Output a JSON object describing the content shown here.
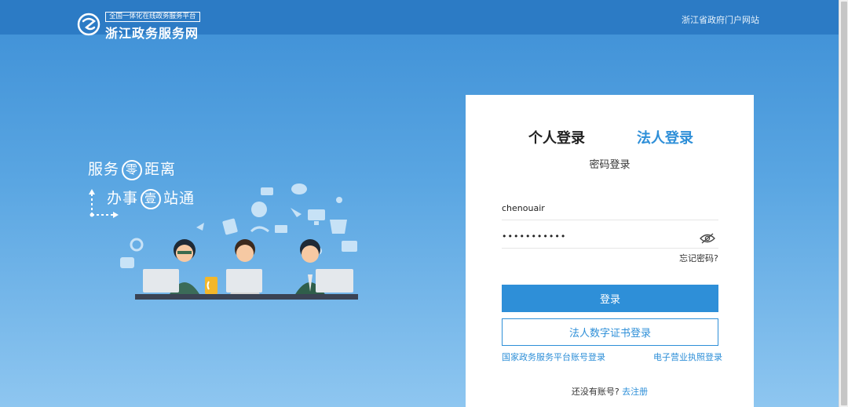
{
  "header": {
    "logo_tagline": "全国一体化在线政务服务平台",
    "logo_name": "浙江政务服务网",
    "portal_link": "浙江省政府门户网站"
  },
  "hero": {
    "slogan_line1_a": "服务",
    "slogan_line1_circle": "零",
    "slogan_line1_b": "距离",
    "slogan_line2_a": "办事",
    "slogan_line2_circle": "壹",
    "slogan_line2_b": "站通"
  },
  "login": {
    "tab_personal": "个人登录",
    "tab_legal": "法人登录",
    "subtitle": "密码登录",
    "username_value": "chenouair",
    "password_value": "•••••••••••",
    "forgot_label": "忘记密码?",
    "login_button": "登录",
    "cert_button": "法人数字证书登录",
    "national_link": "国家政务服务平台账号登录",
    "license_link": "电子营业执照登录",
    "no_account_text": "还没有账号?",
    "register_link": "去注册"
  },
  "colors": {
    "accent": "#2e8fd8",
    "header_bg": "#2c7bc5",
    "active_tab": "#2e8fd8"
  },
  "icons": [
    "logo-mark-icon",
    "eye-hidden-icon",
    "arrow-deco-icon"
  ]
}
